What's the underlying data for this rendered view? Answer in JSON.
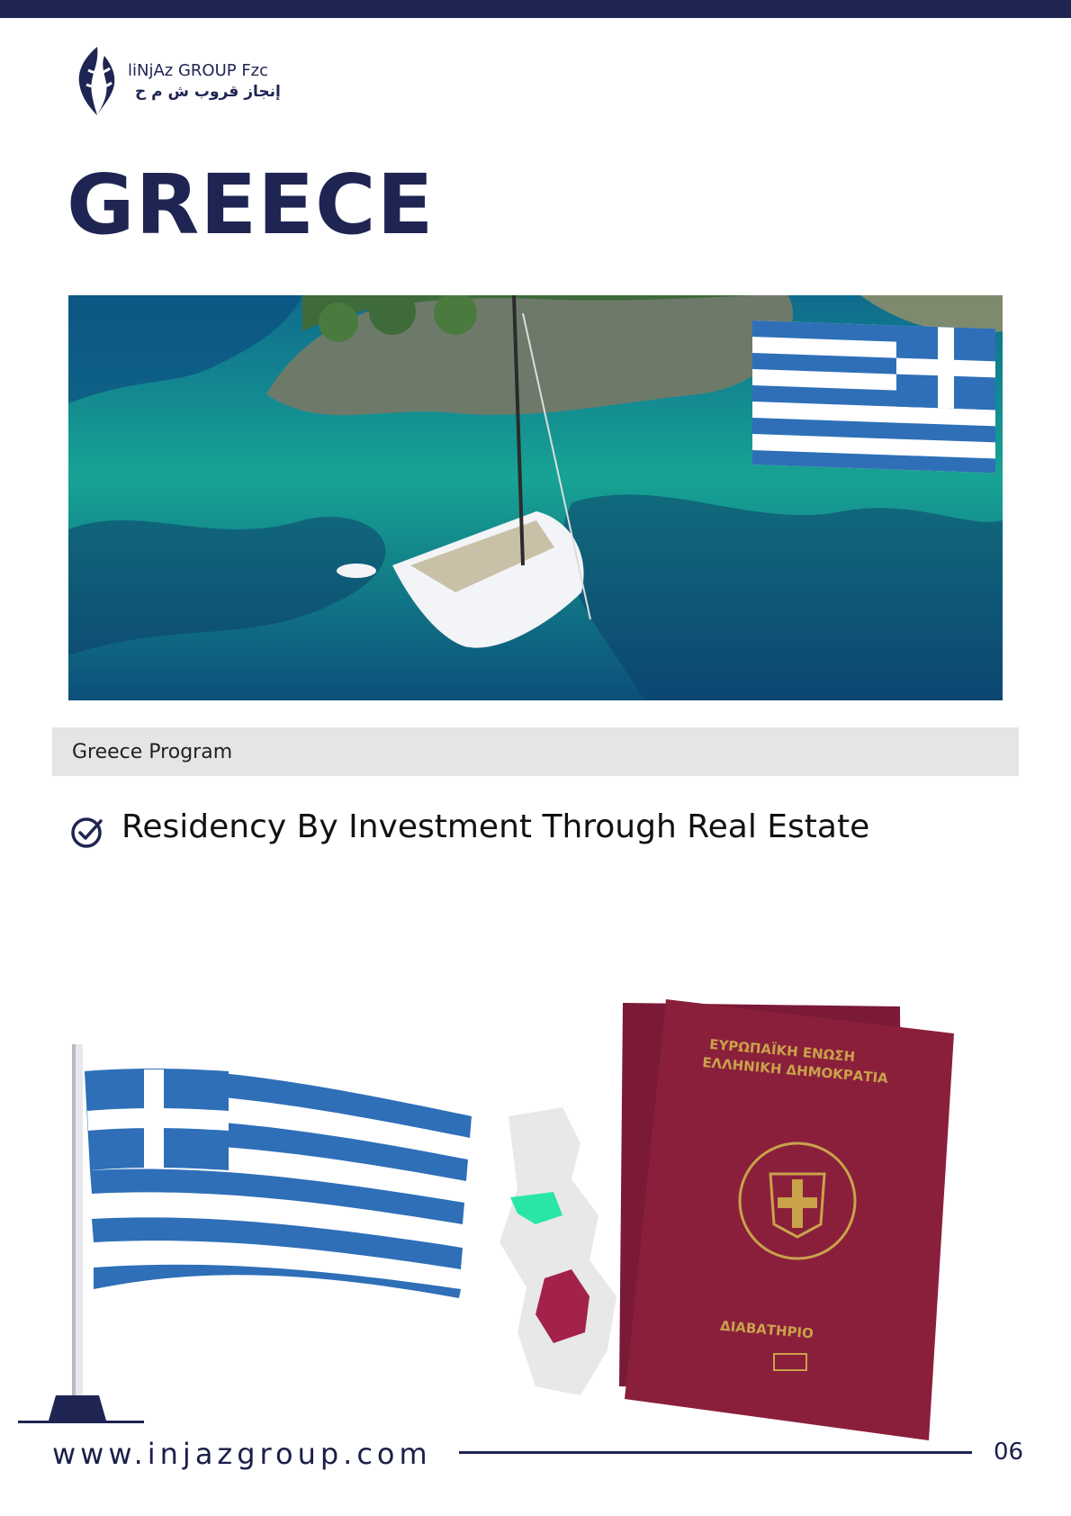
{
  "brand": {
    "name_en": "liNjAz GROUP Fzc",
    "name_ar": "إنجاز قروب ش م ح",
    "colors": {
      "navy": "#1f2552",
      "passport": "#8a1f3c",
      "flag_blue": "#2e6fb8",
      "sea": "#1b9a8c"
    }
  },
  "page": {
    "title": "GREECE",
    "program_label": "Greece Program",
    "bullets": [
      "Residency By Investment Through Real Estate"
    ]
  },
  "passport": {
    "line1": "ΕΥΡΩΠΑΪΚΗ ΕΝΩΣΗ",
    "line2": "ΕΛΛΗΝΙΚΗ ΔΗΜΟΚΡΑΤΙΑ",
    "label": "ΔΙΑΒΑΤΗΡΙΟ"
  },
  "footer": {
    "url": "www.injazgroup.com",
    "page_number": "06"
  },
  "icons": [
    "logo-mark-icon",
    "check-circle-icon"
  ]
}
